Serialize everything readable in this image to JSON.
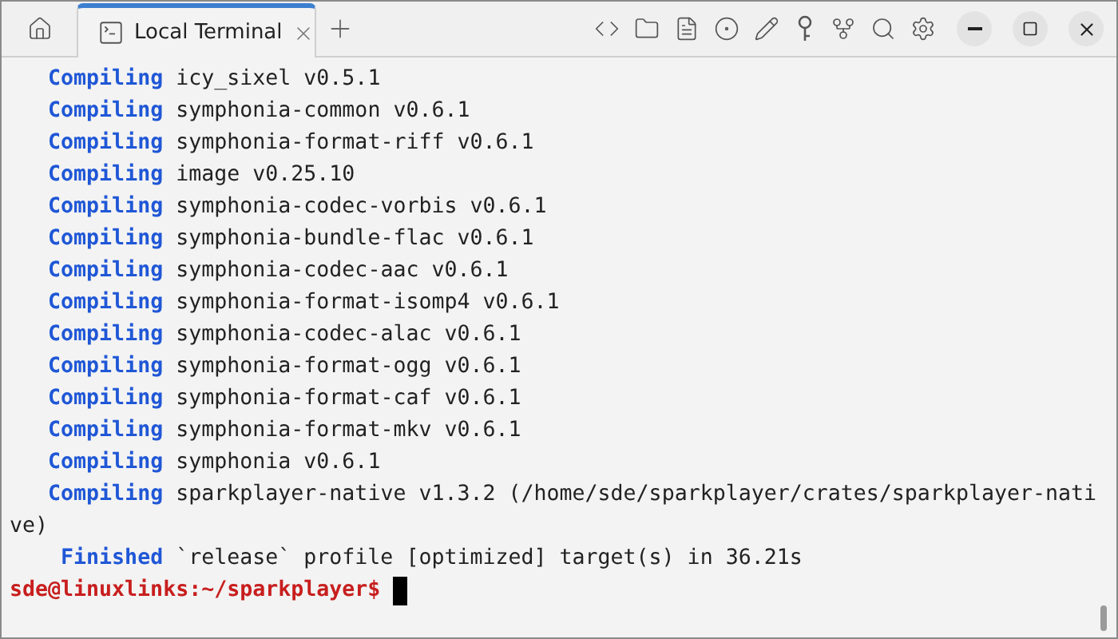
{
  "tabs": [
    {
      "label": "Local Terminal",
      "selected": true
    }
  ],
  "terminal": {
    "lines": [
      {
        "kind": "status",
        "keyword": "Compiling",
        "text": "icy_sixel v0.5.1"
      },
      {
        "kind": "status",
        "keyword": "Compiling",
        "text": "symphonia-common v0.6.1"
      },
      {
        "kind": "status",
        "keyword": "Compiling",
        "text": "symphonia-format-riff v0.6.1"
      },
      {
        "kind": "status",
        "keyword": "Compiling",
        "text": "image v0.25.10"
      },
      {
        "kind": "status",
        "keyword": "Compiling",
        "text": "symphonia-codec-vorbis v0.6.1"
      },
      {
        "kind": "status",
        "keyword": "Compiling",
        "text": "symphonia-bundle-flac v0.6.1"
      },
      {
        "kind": "status",
        "keyword": "Compiling",
        "text": "symphonia-codec-aac v0.6.1"
      },
      {
        "kind": "status",
        "keyword": "Compiling",
        "text": "symphonia-format-isomp4 v0.6.1"
      },
      {
        "kind": "status",
        "keyword": "Compiling",
        "text": "symphonia-codec-alac v0.6.1"
      },
      {
        "kind": "status",
        "keyword": "Compiling",
        "text": "symphonia-format-ogg v0.6.1"
      },
      {
        "kind": "status",
        "keyword": "Compiling",
        "text": "symphonia-format-caf v0.6.1"
      },
      {
        "kind": "status",
        "keyword": "Compiling",
        "text": "symphonia-format-mkv v0.6.1"
      },
      {
        "kind": "status",
        "keyword": "Compiling",
        "text": "symphonia v0.6.1"
      },
      {
        "kind": "status",
        "keyword": "Compiling",
        "text": "sparkplayer-native v1.3.2 (/home/sde/sparkplayer/crates/sparkplayer-native)"
      },
      {
        "kind": "status",
        "keyword": "Finished",
        "text": "`release` profile [optimized] target(s) in 36.21s"
      },
      {
        "kind": "prompt",
        "text": "sde@linuxlinks:~/sparkplayer$"
      }
    ]
  }
}
